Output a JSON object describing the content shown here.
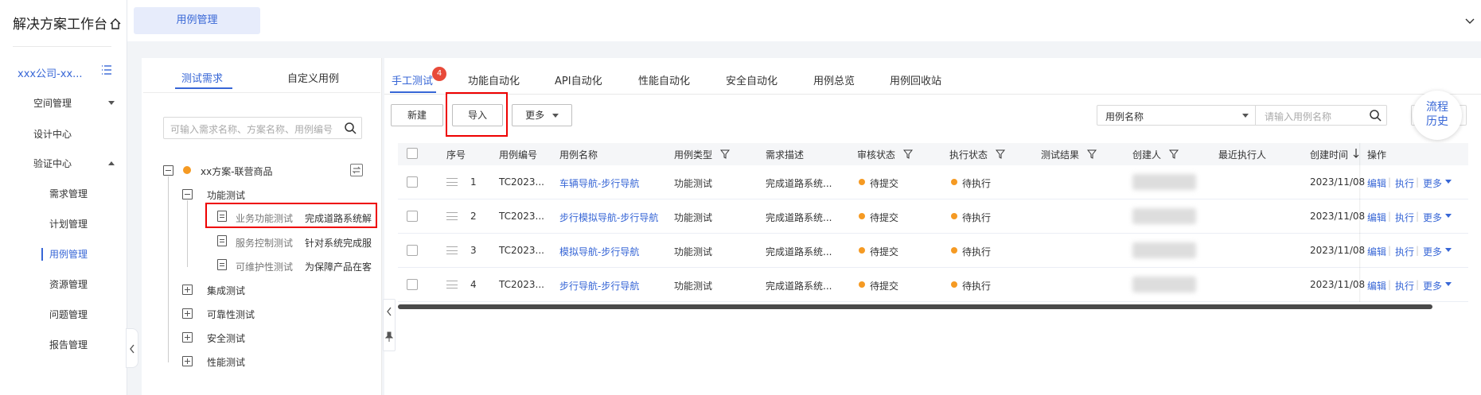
{
  "sidebar": {
    "title": "解决方案工作台",
    "org": "xxx公司-xx...",
    "items": [
      {
        "label": "空间管理",
        "sub": false,
        "arrow": "down"
      },
      {
        "label": "设计中心",
        "sub": false
      },
      {
        "label": "验证中心",
        "sub": false,
        "arrow": "up"
      },
      {
        "label": "需求管理",
        "sub": true
      },
      {
        "label": "计划管理",
        "sub": true
      },
      {
        "label": "用例管理",
        "sub": true,
        "active": true
      },
      {
        "label": "资源管理",
        "sub": true
      },
      {
        "label": "问题管理",
        "sub": true
      },
      {
        "label": "报告管理",
        "sub": true
      }
    ]
  },
  "topbar": {
    "tab": "用例管理"
  },
  "left_panel": {
    "tabs": [
      "测试需求",
      "自定义用例"
    ],
    "search_placeholder": "可输入需求名称、方案名称、用例编号",
    "tree": {
      "root": "xx方案-联营商品",
      "func": "功能测试",
      "leaves": [
        {
          "name": "业务功能测试",
          "desc": "完成道路系统解"
        },
        {
          "name": "服务控制测试",
          "desc": "针对系统完成服"
        },
        {
          "name": "可维护性测试",
          "desc": "为保障产品在客"
        }
      ],
      "others": [
        "集成测试",
        "可靠性测试",
        "安全测试",
        "性能测试"
      ]
    }
  },
  "main": {
    "tabs": [
      "手工测试",
      "功能自动化",
      "API自动化",
      "性能自动化",
      "安全自动化",
      "用例总览",
      "用例回收站"
    ],
    "badge": "4",
    "toolbar": {
      "new": "新建",
      "import": "导入",
      "more": "更多"
    },
    "filter_select": "用例名称",
    "filter_placeholder": "请输入用例名称",
    "flow_history": [
      "流程",
      "历史"
    ],
    "columns": [
      "序号",
      "用例编号",
      "用例名称",
      "用例类型",
      "需求描述",
      "审核状态",
      "执行状态",
      "测试结果",
      "创建人",
      "最近执行人",
      "创建时间",
      "操作"
    ],
    "rows": [
      {
        "no": "1",
        "id": "TC2023...",
        "name": "车辆导航-步行导航",
        "type": "功能测试",
        "desc": "完成道路系统...",
        "review": "待提交",
        "exec": "待执行",
        "time": "2023/11/08"
      },
      {
        "no": "2",
        "id": "TC2023...",
        "name": "步行模拟导航-步行导航",
        "type": "功能测试",
        "desc": "完成道路系统...",
        "review": "待提交",
        "exec": "待执行",
        "time": "2023/11/08"
      },
      {
        "no": "3",
        "id": "TC2023...",
        "name": "模拟导航-步行导航",
        "type": "功能测试",
        "desc": "完成道路系统...",
        "review": "待提交",
        "exec": "待执行",
        "time": "2023/11/08"
      },
      {
        "no": "4",
        "id": "TC2023...",
        "name": "步行导航-步行导航",
        "type": "功能测试",
        "desc": "完成道路系统...",
        "review": "待提交",
        "exec": "待执行",
        "time": "2023/11/08"
      }
    ],
    "ops": {
      "edit": "编辑",
      "run": "执行",
      "more": "更多"
    },
    "colors": {
      "accent": "#3766d6",
      "pending": "#f59a23",
      "highlight": "#e00000"
    }
  }
}
